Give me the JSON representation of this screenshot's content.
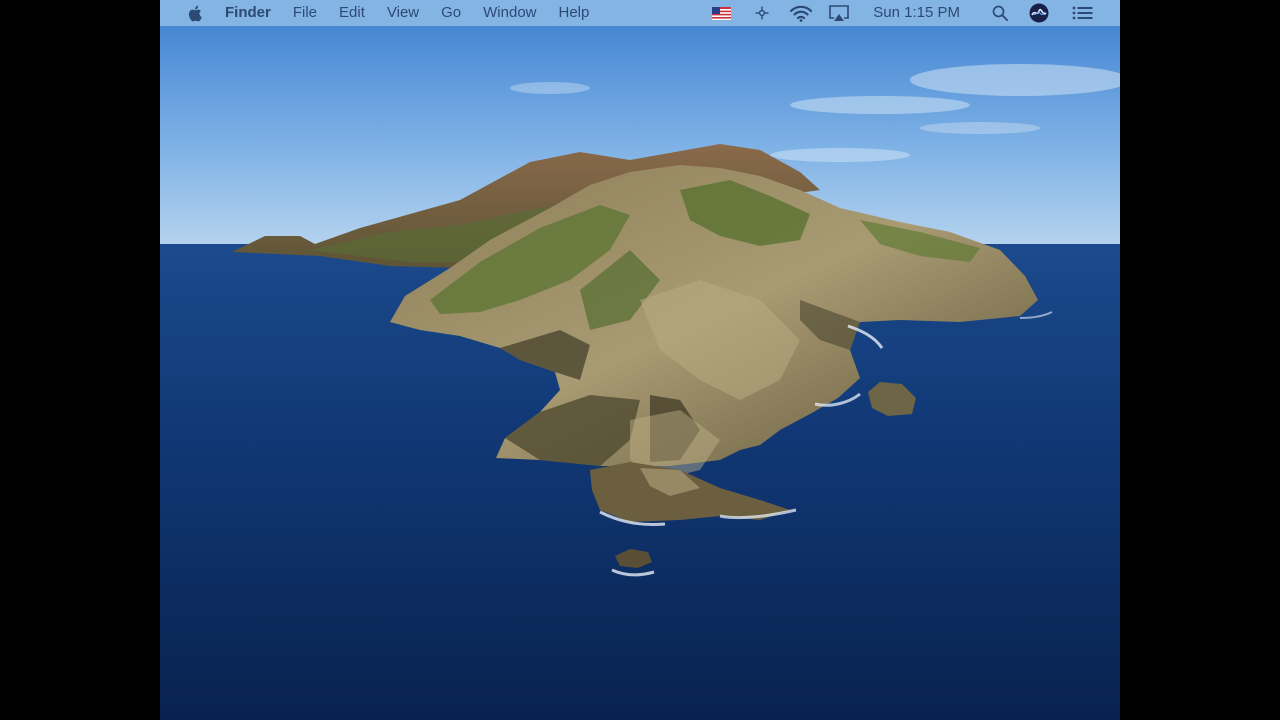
{
  "menubar": {
    "apple_icon": "apple-logo-icon",
    "app_name": "Finder",
    "menus": [
      "File",
      "Edit",
      "View",
      "Go",
      "Window",
      "Help"
    ],
    "status_items": [
      "flag-us-icon",
      "accessibility-icon",
      "wifi-icon",
      "airplay-icon"
    ],
    "clock": "Sun 1:15 PM",
    "spotlight_icon": "search-icon",
    "siri_icon": "siri-icon",
    "control_icon": "list-icon"
  },
  "colors": {
    "menubar_bg": "#8ab8e4",
    "menubar_text": "#2d4a75",
    "sky_top": "#3f82d0",
    "sea": "#0e2f6a"
  }
}
